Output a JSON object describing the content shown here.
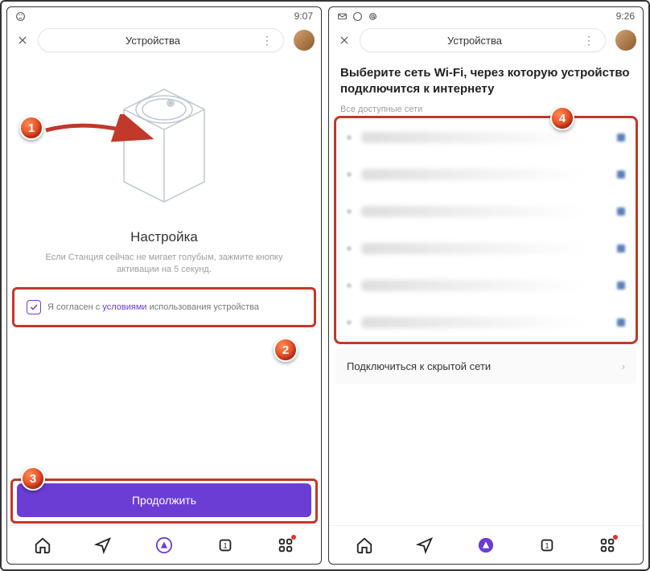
{
  "left": {
    "time": "9:07",
    "header_title": "Устройства",
    "setup_title": "Настройка",
    "setup_desc": "Если Станция сейчас не мигает голубым, зажмите кнопку активации на 5 секунд.",
    "agree_pre": "Я согласен с ",
    "agree_link": "условиями",
    "agree_post": " использования устройства",
    "continue": "Продолжить"
  },
  "right": {
    "time": "9:26",
    "header_title": "Устройства",
    "title": "Выберите сеть Wi-Fi, через которую устройство подключится к интернету",
    "subtitle": "Все доступные сети",
    "hidden_label": "Подключиться к скрытой сети"
  },
  "markers": {
    "m1": "1",
    "m2": "2",
    "m3": "3",
    "m4": "4"
  }
}
